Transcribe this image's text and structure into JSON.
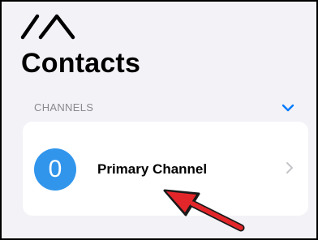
{
  "app": {
    "logo_icon": "meshtastic-logo-icon",
    "title": "Contacts"
  },
  "channels_section": {
    "header": "CHANNELS",
    "toggle_icon": "chevron-down-icon",
    "accent_color": "#007aff",
    "items": [
      {
        "index": "0",
        "name": "Primary Channel",
        "avatar_color": "#3195ec",
        "disclosure_icon": "chevron-right-icon"
      }
    ]
  },
  "annotation": {
    "icon": "red-arrow-annotation",
    "color": "#e3262a"
  }
}
